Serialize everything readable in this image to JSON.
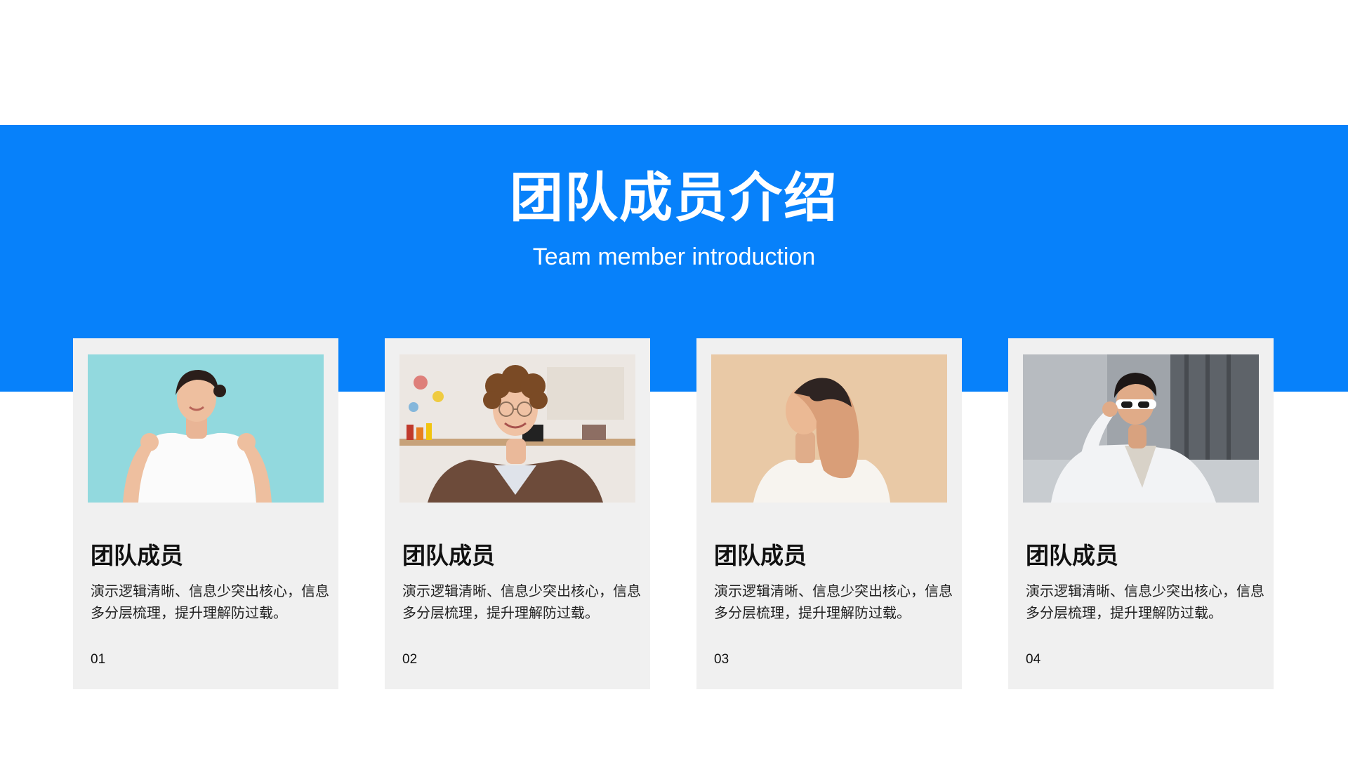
{
  "slide": {
    "title": "团队成员介绍",
    "subtitle": "Team member introduction",
    "accent_color": "#0781fa"
  },
  "members": [
    {
      "name": "团队成员",
      "description": "演示逻辑清晰、信息少突出核心，信息多分层梳理，提升理解防过载。",
      "number": "01",
      "photo": "woman-pointing-at-self-photo"
    },
    {
      "name": "团队成员",
      "description": "演示逻辑清晰、信息少突出核心，信息多分层梳理，提升理解防过载。",
      "number": "02",
      "photo": "smiling-teacher-with-glasses-photo"
    },
    {
      "name": "团队成员",
      "description": "演示逻辑清晰、信息少突出核心，信息多分层梳理，提升理解防过载。",
      "number": "03",
      "photo": "woman-side-profile-photo"
    },
    {
      "name": "团队成员",
      "description": "演示逻辑清晰、信息少突出核心，信息多分层梳理，提升理解防过载。",
      "number": "04",
      "photo": "man-with-white-sunglasses-photo"
    }
  ]
}
